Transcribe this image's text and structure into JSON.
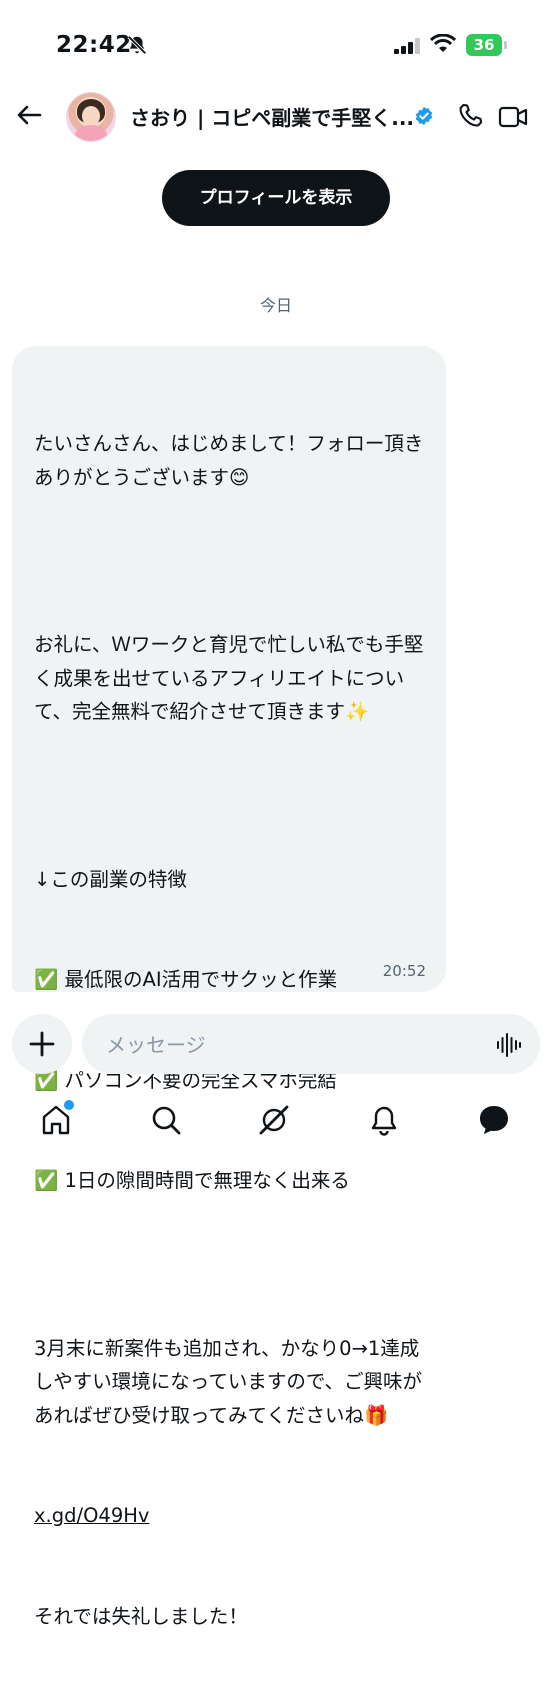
{
  "status_bar": {
    "time": "22:42",
    "battery": "36"
  },
  "header": {
    "title": "さおり | コピペ副業で手堅く..."
  },
  "profile_button": {
    "label": "プロフィールを表示"
  },
  "date_divider": "今日",
  "message": {
    "lines": [
      "たいさんさん、はじめまして！フォロー頂きありがとうございます😊",
      "",
      "お礼に、Ｗワークと育児で忙しい私でも手堅く成果を出せているアフィリエイトについて、完全無料で紹介させて頂きます✨",
      "",
      "↓この副業の特徴",
      "✅ 最低限のAI活用でサクッと作業",
      "✅ パソコン不要の完全スマホ完結",
      "✅ 1日の隙間時間で無理なく出来る",
      "",
      "3月末に新案件も追加され、かなり0→1達成しやすい環境になっていますので、ご興味があればぜひ受け取ってみてくださいね🎁"
    ],
    "link": "x.gd/O49Hv",
    "closing": "それでは失礼しました！",
    "time": "20:52"
  },
  "composer": {
    "placeholder": "メッセージ"
  },
  "icons": {
    "back": "arrow-left-icon",
    "verified": "verified-badge-icon",
    "call": "phone-icon",
    "video": "video-icon",
    "add": "plus-icon",
    "voice": "waveform-icon",
    "home": "home-icon",
    "search": "search-icon",
    "grok": "grok-icon",
    "notifications": "bell-icon",
    "messages": "message-icon"
  },
  "colors": {
    "accent": "#1d9bf0",
    "bubble": "#eff3f4",
    "button": "#0f1419",
    "battery": "#34c759"
  }
}
